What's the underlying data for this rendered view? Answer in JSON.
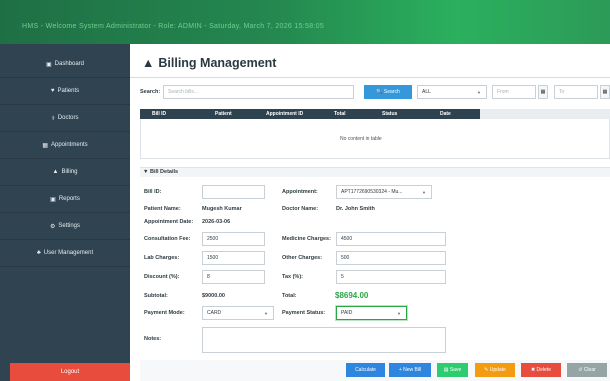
{
  "header": {
    "title": "HMS - Welcome System Administrator - Role: ADMIN - Saturday, March 7, 2026 15:58:05"
  },
  "sidebar": {
    "items": [
      {
        "icon": "▣",
        "label": "Dashboard"
      },
      {
        "icon": "♥",
        "label": "Patients"
      },
      {
        "icon": "⚕",
        "label": "Doctors"
      },
      {
        "icon": "▦",
        "label": "Appointments"
      },
      {
        "icon": "▲",
        "label": "Billing"
      },
      {
        "icon": "▣",
        "label": "Reports"
      },
      {
        "icon": "⚙",
        "label": "Settings"
      },
      {
        "icon": "♣",
        "label": "User Management"
      }
    ],
    "logout": "Logout"
  },
  "page": {
    "title": "Billing Management",
    "title_icon": "▲"
  },
  "search": {
    "label": "Search:",
    "placeholder": "Search bills...",
    "button": "🔍 Search",
    "filter": "ALL",
    "from_placeholder": "From",
    "to_placeholder": "To",
    "calendar_icon": "▦"
  },
  "table": {
    "columns": [
      "Bill ID",
      "Patient",
      "Appointment ID",
      "Total",
      "Status",
      "Date"
    ],
    "empty": "No content in table"
  },
  "details": {
    "section_title": "▼  Bill Details",
    "bill_id_label": "Bill ID:",
    "bill_id_value": "",
    "appointment_label": "Appointment:",
    "appointment_value": "APT1772690530324 - Mu...",
    "patient_name_label": "Patient Name:",
    "patient_name_value": "Mugesh Kumar",
    "doctor_name_label": "Doctor Name:",
    "doctor_name_value": "Dr. John Smith",
    "appt_date_label": "Appointment Date:",
    "appt_date_value": "2026-03-06",
    "consultation_label": "Consultation Fee:",
    "consultation_value": "2500",
    "medicine_label": "Medicine Charges:",
    "medicine_value": "4500",
    "lab_label": "Lab Charges:",
    "lab_value": "1500",
    "other_label": "Other Charges:",
    "other_value": "500",
    "discount_label": "Discount (%):",
    "discount_value": "8",
    "tax_label": "Tax (%):",
    "tax_value": "5",
    "subtotal_label": "Subtotal:",
    "subtotal_value": "$9000.00",
    "total_label": "Total:",
    "total_value": "$8694.00",
    "payment_mode_label": "Payment Mode:",
    "payment_mode_value": "CARD",
    "payment_status_label": "Payment Status:",
    "payment_status_value": "PAID",
    "notes_label": "Notes:",
    "notes_value": ""
  },
  "actions": {
    "calculate": "Calculate",
    "new_bill": "+ New Bill",
    "save": "▤ Save",
    "update": "✎ Update",
    "delete": "✖ Delete",
    "clear": "↺ Clear"
  },
  "colors": {
    "sidebar": "#2f4350",
    "search_button": "#3498db",
    "calculate": "#2e86de",
    "new_bill": "#2e86de",
    "save": "#2ecc71",
    "update": "#f39c12",
    "delete": "#e74c3c",
    "clear": "#95a5a6",
    "logout": "#e74c3c",
    "total": "#28a745"
  }
}
